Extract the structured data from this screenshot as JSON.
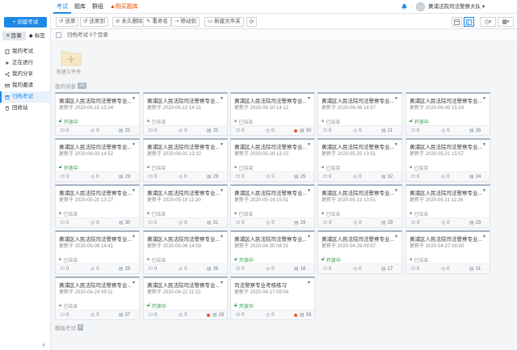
{
  "nav": {
    "items": [
      {
        "label": "考试",
        "active": true
      },
      {
        "label": "题库",
        "active": false
      },
      {
        "label": "群组",
        "active": false
      },
      {
        "label": "购买题库",
        "active": false,
        "hot": true
      }
    ]
  },
  "user": {
    "name": "黄浦法院司法警察大队"
  },
  "sidebar": {
    "create_label": "+ 创建考试",
    "tabs": [
      {
        "label": "目录",
        "active": true
      },
      {
        "label": "标签",
        "active": false
      }
    ],
    "items": [
      {
        "label": "我的考试",
        "icon": "file-icon",
        "active": false
      },
      {
        "label": "正在进行",
        "icon": "play-icon",
        "active": false
      },
      {
        "label": "我的分享",
        "icon": "share-icon",
        "active": false
      },
      {
        "label": "我的邀请",
        "icon": "mail-icon",
        "active": false
      },
      {
        "label": "归档考试",
        "icon": "archive-icon",
        "active": true
      },
      {
        "label": "回收站",
        "icon": "trash-icon",
        "active": false
      }
    ],
    "collapse_glyph": "«"
  },
  "toolbar": {
    "buttons": [
      {
        "label": "还原",
        "icon": "undo-icon"
      },
      {
        "label": "还原到",
        "icon": "undo-to-icon"
      },
      {
        "label": "永久删除",
        "icon": "delete-icon"
      },
      {
        "label": "重命名",
        "icon": "edit-icon"
      },
      {
        "label": "移动到",
        "icon": "move-icon"
      },
      {
        "label": "新建文件夹",
        "icon": "folder-add-icon"
      }
    ]
  },
  "breadcrumb": {
    "text": "归档考试 0个目录"
  },
  "folder": {
    "label": "新建文件夹"
  },
  "section_mine": {
    "label": "我的试卷",
    "count": "23"
  },
  "section_shared": {
    "label": "模板考试",
    "count": "0"
  },
  "colors": {
    "accent": "#1e88e5",
    "open": "#2e9b45",
    "closed": "#999999",
    "alert": "#e8572a"
  },
  "cards": [
    {
      "title": "黄浦区人民法院司法警察专业...",
      "date": "更新于 2020-06-15 13:34",
      "status": "开放中",
      "status_type": "open",
      "a": "0",
      "b": "0",
      "c": "25",
      "alert": false
    },
    {
      "title": "黄浦区人民法院司法警察专业...",
      "date": "更新于 2020-06-12 14:31",
      "status": "已结束",
      "status_type": "closed",
      "a": "0",
      "b": "0",
      "c": "25",
      "alert": false
    },
    {
      "title": "黄浦区人民法院司法警察专业...",
      "date": "更新于 2020-06-10 14:12",
      "status": "已结束",
      "status_type": "closed",
      "a": "0",
      "b": "0",
      "c": "30",
      "alert": true
    },
    {
      "title": "黄浦区人民法院司法警察专业...",
      "date": "更新于 2020-06-08 14:37",
      "status": "已结束",
      "status_type": "closed",
      "a": "0",
      "b": "0",
      "c": "21",
      "alert": false
    },
    {
      "title": "黄浦区人民法院司法警察专业...",
      "date": "更新于 2020-06-05 15:24",
      "status": "开放中",
      "status_type": "open",
      "a": "0",
      "b": "0",
      "c": "26",
      "alert": false
    },
    {
      "title": "黄浦区人民法院司法警察专业...",
      "date": "更新于 2020-06-03 14:52",
      "status": "开放中",
      "status_type": "open",
      "a": "0",
      "b": "0",
      "c": "29",
      "alert": false
    },
    {
      "title": "黄浦区人民法院司法警察专业...",
      "date": "更新于 2020-06-01 13:32",
      "status": "已结束",
      "status_type": "closed",
      "a": "0",
      "b": "0",
      "c": "29",
      "alert": false
    },
    {
      "title": "黄浦区人民法院司法警察专业...",
      "date": "更新于 2020-05-29 13:15",
      "status": "已结束",
      "status_type": "closed",
      "a": "0",
      "b": "0",
      "c": "25",
      "alert": false
    },
    {
      "title": "黄浦区人民法院司法警察专业...",
      "date": "更新于 2020-05-25 13:51",
      "status": "已结束",
      "status_type": "closed",
      "a": "0",
      "b": "0",
      "c": "32",
      "alert": false
    },
    {
      "title": "黄浦区人民法院司法警察专业...",
      "date": "更新于 2020-05-21 15:57",
      "status": "已结束",
      "status_type": "closed",
      "a": "0",
      "b": "0",
      "c": "24",
      "alert": false
    },
    {
      "title": "黄浦区人民法院司法警察专业...",
      "date": "更新于 2020-05-20 13:27",
      "status": "已结束",
      "status_type": "closed",
      "a": "0",
      "b": "0",
      "c": "30",
      "alert": false
    },
    {
      "title": "黄浦区人民法院司法警察专业...",
      "date": "更新于 2020-05-18 11:20",
      "status": "已结束",
      "status_type": "closed",
      "a": "0",
      "b": "0",
      "c": "31",
      "alert": false
    },
    {
      "title": "黄浦区人民法院司法警察专业...",
      "date": "更新于 2020-05-14 15:51",
      "status": "已结束",
      "status_type": "closed",
      "a": "0",
      "b": "0",
      "c": "29",
      "alert": false
    },
    {
      "title": "黄浦区人民法院司法警察专业...",
      "date": "更新于 2020-05-13 13:51",
      "status": "已结束",
      "status_type": "closed",
      "a": "0",
      "b": "0",
      "c": "29",
      "alert": false
    },
    {
      "title": "黄浦区人民法院司法警察专业...",
      "date": "更新于 2020-05-11 11:26",
      "status": "已结束",
      "status_type": "closed",
      "a": "0",
      "b": "0",
      "c": "29",
      "alert": false
    },
    {
      "title": "黄浦区人民法院司法警察专业...",
      "date": "更新于 2020-05-08 14:41",
      "status": "已结束",
      "status_type": "closed",
      "a": "0",
      "b": "0",
      "c": "28",
      "alert": false
    },
    {
      "title": "黄浦区人民法院司法警察专业...",
      "date": "更新于 2020-05-06 14:59",
      "status": "已结束",
      "status_type": "closed",
      "a": "0",
      "b": "0",
      "c": "26",
      "alert": false
    },
    {
      "title": "黄浦区人民法院司法警察专业...",
      "date": "更新于 2020-04-30 08:31",
      "status": "开放中",
      "status_type": "open",
      "a": "0",
      "b": "0",
      "c": "18",
      "alert": false
    },
    {
      "title": "黄浦区人民法院司法警察专业...",
      "date": "更新于 2020-04-29 09:57",
      "status": "开放中",
      "status_type": "open",
      "a": "0",
      "b": "0",
      "c": "27",
      "alert": false
    },
    {
      "title": "黄浦区人民法院司法警察专业...",
      "date": "更新于 2020-04-27 09:50",
      "status": "已结束",
      "status_type": "closed",
      "a": "0",
      "b": "0",
      "c": "31",
      "alert": false
    },
    {
      "title": "黄浦区人民法院司法警察专业...",
      "date": "更新于 2020-04-24 09:11",
      "status": "已结束",
      "status_type": "closed",
      "a": "0",
      "b": "0",
      "c": "37",
      "alert": false
    },
    {
      "title": "黄浦区人民法院司法警察专业...",
      "date": "更新于 2020-04-22 11:22",
      "status": "开放中",
      "status_type": "open",
      "a": "0",
      "b": "0",
      "c": "26",
      "alert": true
    },
    {
      "title": "司法警察专业考核练习",
      "date": "更新于 2020-04-17 09:04",
      "status": "开放中",
      "status_type": "open",
      "a": "0",
      "b": "0",
      "c": "59",
      "alert": true
    }
  ]
}
